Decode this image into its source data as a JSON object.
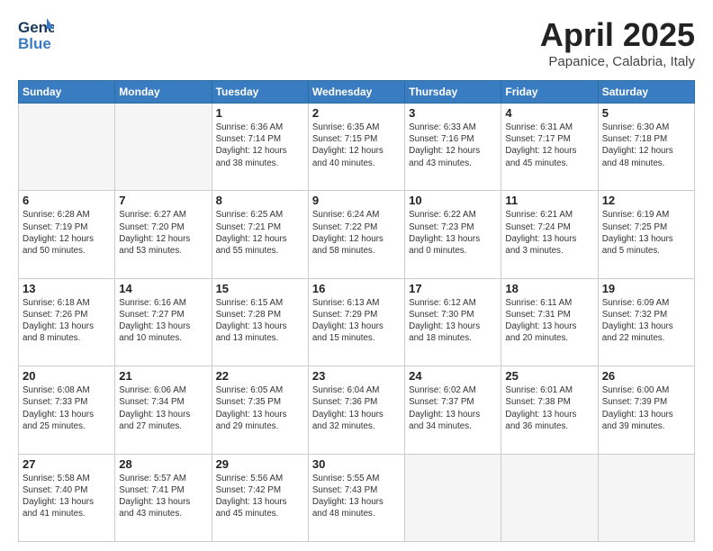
{
  "header": {
    "logo_line1": "General",
    "logo_line2": "Blue",
    "month": "April 2025",
    "location": "Papanice, Calabria, Italy"
  },
  "weekdays": [
    "Sunday",
    "Monday",
    "Tuesday",
    "Wednesday",
    "Thursday",
    "Friday",
    "Saturday"
  ],
  "weeks": [
    [
      {
        "day": "",
        "info": ""
      },
      {
        "day": "",
        "info": ""
      },
      {
        "day": "1",
        "info": "Sunrise: 6:36 AM\nSunset: 7:14 PM\nDaylight: 12 hours\nand 38 minutes."
      },
      {
        "day": "2",
        "info": "Sunrise: 6:35 AM\nSunset: 7:15 PM\nDaylight: 12 hours\nand 40 minutes."
      },
      {
        "day": "3",
        "info": "Sunrise: 6:33 AM\nSunset: 7:16 PM\nDaylight: 12 hours\nand 43 minutes."
      },
      {
        "day": "4",
        "info": "Sunrise: 6:31 AM\nSunset: 7:17 PM\nDaylight: 12 hours\nand 45 minutes."
      },
      {
        "day": "5",
        "info": "Sunrise: 6:30 AM\nSunset: 7:18 PM\nDaylight: 12 hours\nand 48 minutes."
      }
    ],
    [
      {
        "day": "6",
        "info": "Sunrise: 6:28 AM\nSunset: 7:19 PM\nDaylight: 12 hours\nand 50 minutes."
      },
      {
        "day": "7",
        "info": "Sunrise: 6:27 AM\nSunset: 7:20 PM\nDaylight: 12 hours\nand 53 minutes."
      },
      {
        "day": "8",
        "info": "Sunrise: 6:25 AM\nSunset: 7:21 PM\nDaylight: 12 hours\nand 55 minutes."
      },
      {
        "day": "9",
        "info": "Sunrise: 6:24 AM\nSunset: 7:22 PM\nDaylight: 12 hours\nand 58 minutes."
      },
      {
        "day": "10",
        "info": "Sunrise: 6:22 AM\nSunset: 7:23 PM\nDaylight: 13 hours\nand 0 minutes."
      },
      {
        "day": "11",
        "info": "Sunrise: 6:21 AM\nSunset: 7:24 PM\nDaylight: 13 hours\nand 3 minutes."
      },
      {
        "day": "12",
        "info": "Sunrise: 6:19 AM\nSunset: 7:25 PM\nDaylight: 13 hours\nand 5 minutes."
      }
    ],
    [
      {
        "day": "13",
        "info": "Sunrise: 6:18 AM\nSunset: 7:26 PM\nDaylight: 13 hours\nand 8 minutes."
      },
      {
        "day": "14",
        "info": "Sunrise: 6:16 AM\nSunset: 7:27 PM\nDaylight: 13 hours\nand 10 minutes."
      },
      {
        "day": "15",
        "info": "Sunrise: 6:15 AM\nSunset: 7:28 PM\nDaylight: 13 hours\nand 13 minutes."
      },
      {
        "day": "16",
        "info": "Sunrise: 6:13 AM\nSunset: 7:29 PM\nDaylight: 13 hours\nand 15 minutes."
      },
      {
        "day": "17",
        "info": "Sunrise: 6:12 AM\nSunset: 7:30 PM\nDaylight: 13 hours\nand 18 minutes."
      },
      {
        "day": "18",
        "info": "Sunrise: 6:11 AM\nSunset: 7:31 PM\nDaylight: 13 hours\nand 20 minutes."
      },
      {
        "day": "19",
        "info": "Sunrise: 6:09 AM\nSunset: 7:32 PM\nDaylight: 13 hours\nand 22 minutes."
      }
    ],
    [
      {
        "day": "20",
        "info": "Sunrise: 6:08 AM\nSunset: 7:33 PM\nDaylight: 13 hours\nand 25 minutes."
      },
      {
        "day": "21",
        "info": "Sunrise: 6:06 AM\nSunset: 7:34 PM\nDaylight: 13 hours\nand 27 minutes."
      },
      {
        "day": "22",
        "info": "Sunrise: 6:05 AM\nSunset: 7:35 PM\nDaylight: 13 hours\nand 29 minutes."
      },
      {
        "day": "23",
        "info": "Sunrise: 6:04 AM\nSunset: 7:36 PM\nDaylight: 13 hours\nand 32 minutes."
      },
      {
        "day": "24",
        "info": "Sunrise: 6:02 AM\nSunset: 7:37 PM\nDaylight: 13 hours\nand 34 minutes."
      },
      {
        "day": "25",
        "info": "Sunrise: 6:01 AM\nSunset: 7:38 PM\nDaylight: 13 hours\nand 36 minutes."
      },
      {
        "day": "26",
        "info": "Sunrise: 6:00 AM\nSunset: 7:39 PM\nDaylight: 13 hours\nand 39 minutes."
      }
    ],
    [
      {
        "day": "27",
        "info": "Sunrise: 5:58 AM\nSunset: 7:40 PM\nDaylight: 13 hours\nand 41 minutes."
      },
      {
        "day": "28",
        "info": "Sunrise: 5:57 AM\nSunset: 7:41 PM\nDaylight: 13 hours\nand 43 minutes."
      },
      {
        "day": "29",
        "info": "Sunrise: 5:56 AM\nSunset: 7:42 PM\nDaylight: 13 hours\nand 45 minutes."
      },
      {
        "day": "30",
        "info": "Sunrise: 5:55 AM\nSunset: 7:43 PM\nDaylight: 13 hours\nand 48 minutes."
      },
      {
        "day": "",
        "info": ""
      },
      {
        "day": "",
        "info": ""
      },
      {
        "day": "",
        "info": ""
      }
    ]
  ]
}
